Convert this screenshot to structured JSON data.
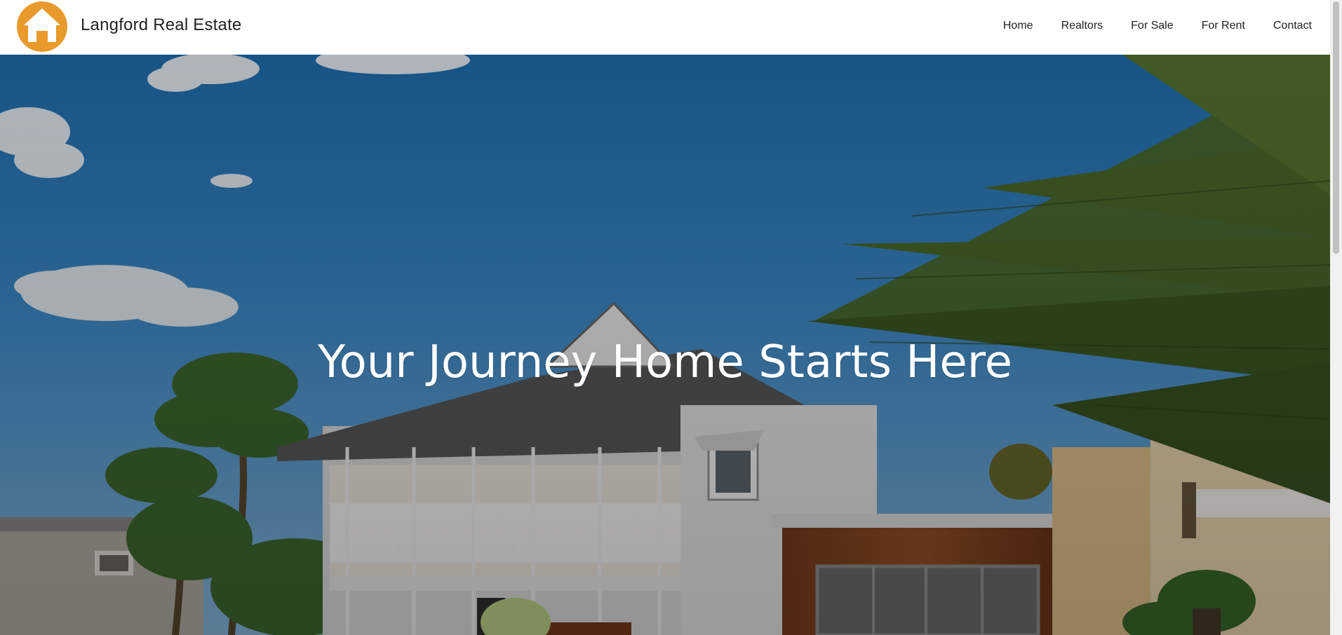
{
  "header": {
    "brand_name": "Langford Real Estate",
    "logo_icon": "house-icon"
  },
  "nav": {
    "items": [
      {
        "label": "Home"
      },
      {
        "label": "Realtors"
      },
      {
        "label": "For Sale"
      },
      {
        "label": "For Rent"
      },
      {
        "label": "Contact"
      }
    ]
  },
  "hero": {
    "title": "Your Journey Home Starts Here"
  },
  "colors": {
    "accent_orange": "#e89a2c",
    "sky_blue": "#3a86c8",
    "header_bg": "#ffffff",
    "text_dark": "#222222"
  }
}
